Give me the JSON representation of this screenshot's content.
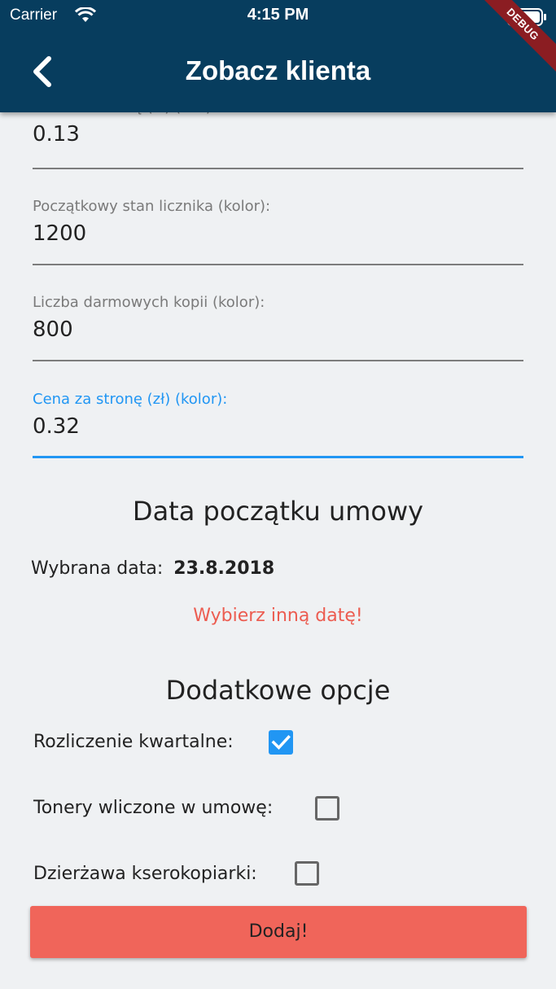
{
  "status_bar": {
    "carrier": "Carrier",
    "time": "4:15 PM"
  },
  "debug_banner": "DEBUG",
  "app_bar": {
    "title": "Zobacz klienta",
    "back_icon": "chevron-left-icon"
  },
  "fields": [
    {
      "label": "Cena za stronę (zł) (czb):",
      "value": "0.13",
      "focused": false
    },
    {
      "label": "Początkowy stan licznika (kolor):",
      "value": "1200",
      "focused": false
    },
    {
      "label": "Liczba darmowych kopii (kolor):",
      "value": "800",
      "focused": false
    },
    {
      "label": "Cena za stronę (zł) (kolor):",
      "value": "0.32",
      "focused": true
    }
  ],
  "contract_start": {
    "heading": "Data początku umowy",
    "selected_label": "Wybrana data:",
    "selected_value": "23.8.2018",
    "change_button": "Wybierz inną datę!"
  },
  "options": {
    "heading": "Dodatkowe opcje",
    "items": [
      {
        "label": "Rozliczenie kwartalne:",
        "checked": true
      },
      {
        "label": "Tonery wliczone w umowę:",
        "checked": false
      },
      {
        "label": "Dzierżawa kserokopiarki:",
        "checked": false
      }
    ]
  },
  "submit_label": "Dodaj!",
  "colors": {
    "app_bar": "#073d5e",
    "accent": "#2196f3",
    "danger": "#f0655a",
    "background": "#eff1f3"
  }
}
